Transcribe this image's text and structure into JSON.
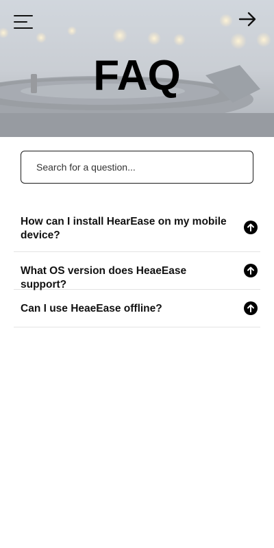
{
  "header": {
    "title": "FAQ",
    "menu_icon": "hamburger-menu-icon",
    "next_icon": "arrow-right-icon"
  },
  "search": {
    "placeholder": "Search for a question...",
    "value": ""
  },
  "faq": {
    "items": [
      {
        "question": "How can I install HearEase on my mobile device?",
        "icon": "arrow-up-circle-icon"
      },
      {
        "question": "What OS version does HeaeEase support?",
        "icon": "arrow-up-circle-icon"
      },
      {
        "question": "Can I use HeaeEase offline?",
        "icon": "arrow-up-circle-icon"
      }
    ]
  },
  "colors": {
    "text": "#111111",
    "divider": "#e3e3e3",
    "border": "#1a1a1a",
    "background": "#ffffff"
  }
}
